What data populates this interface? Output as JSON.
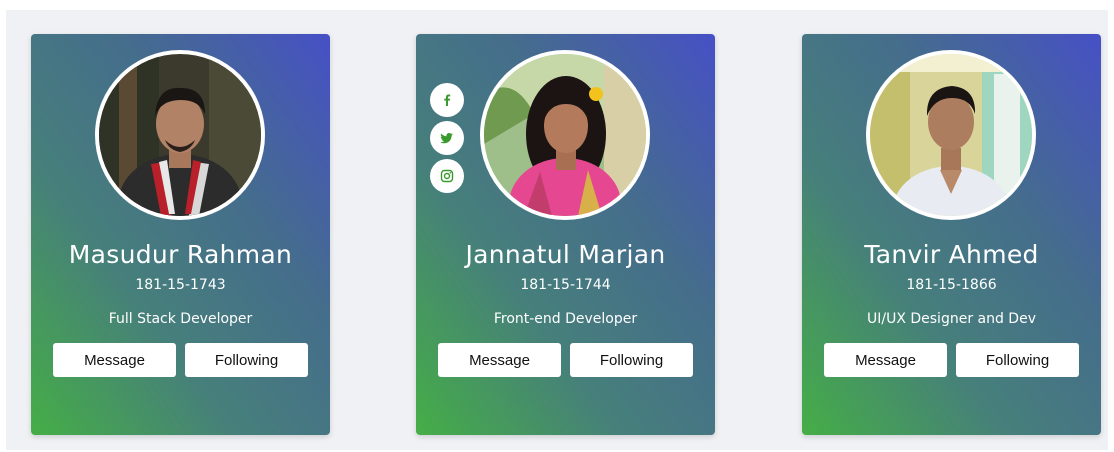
{
  "colors": {
    "gradient_bottom_left": "#45ae46",
    "gradient_top_right": "#4650c6",
    "text": "#ffffff",
    "button_bg": "#ffffff",
    "social_icon": "#3a9a2e"
  },
  "profiles": [
    {
      "name": "Masudur Rahman",
      "id": "181-15-1743",
      "role": "Full Stack Developer",
      "message_label": "Message",
      "following_label": "Following",
      "social_visible": false
    },
    {
      "name": "Jannatul Marjan",
      "id": "181-15-1744",
      "role": "Front-end Developer",
      "message_label": "Message",
      "following_label": "Following",
      "social_visible": true,
      "social_icons": [
        "facebook-icon",
        "twitter-icon",
        "instagram-icon"
      ]
    },
    {
      "name": "Tanvir Ahmed",
      "id": "181-15-1866",
      "role": "UI/UX Designer and Dev",
      "message_label": "Message",
      "following_label": "Following",
      "social_visible": false
    }
  ]
}
